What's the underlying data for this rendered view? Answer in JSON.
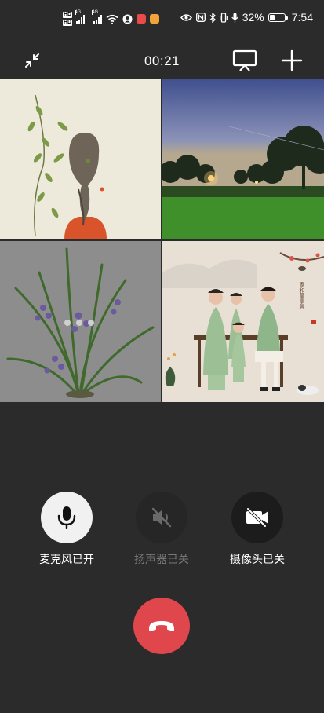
{
  "status_bar": {
    "hd_labels": [
      "HD",
      "HD"
    ],
    "network_1": "4G",
    "network_2": "4G",
    "battery_percent": "32%",
    "time": "7:54"
  },
  "call": {
    "timer": "00:21"
  },
  "grid": {
    "tiles": [
      {
        "name": "tile-girl-illustration"
      },
      {
        "name": "tile-sunset-park"
      },
      {
        "name": "tile-orchid-plant"
      },
      {
        "name": "tile-family-portrait"
      }
    ],
    "portrait_signature": "家和萬事興"
  },
  "controls": {
    "mic_label": "麦克风已开",
    "speaker_label": "扬声器已关",
    "camera_label": "摄像头已关"
  },
  "colors": {
    "background": "#2b2b2b",
    "hangup": "#e0474c",
    "mic_on": "#f1f1f1",
    "disabled_text": "#777777"
  }
}
